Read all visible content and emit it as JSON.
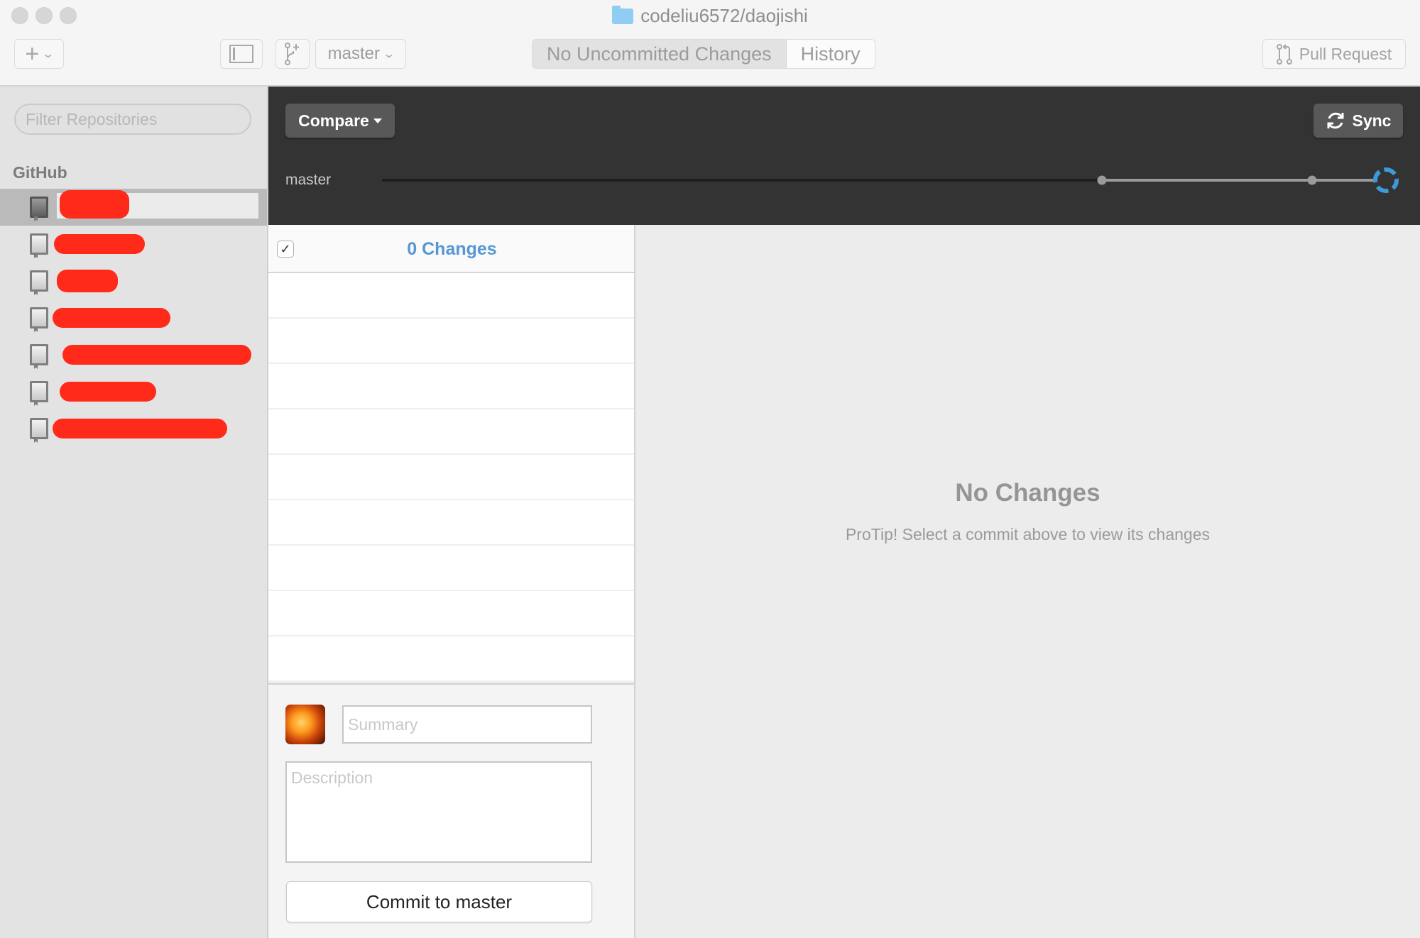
{
  "window": {
    "title": "codeliu6572/daojishi"
  },
  "toolbar": {
    "add_icon": "plus-icon",
    "branch_selector": "master",
    "segments": [
      {
        "label": "No Uncommitted Changes",
        "active": true
      },
      {
        "label": "History",
        "active": false
      }
    ],
    "pull_request_label": "Pull Request"
  },
  "sidebar": {
    "filter_placeholder": "Filter Repositories",
    "section_title": "GitHub",
    "repos": [
      {
        "name": "[redacted]",
        "selected": true
      },
      {
        "name": "[redacted]",
        "selected": false
      },
      {
        "name": "[redacted]",
        "selected": false
      },
      {
        "name": "[redacted]",
        "selected": false
      },
      {
        "name": "[redacted]",
        "selected": false
      },
      {
        "name": "[redacted]",
        "selected": false
      },
      {
        "name": "[redacted]",
        "selected": false
      }
    ]
  },
  "header": {
    "compare_label": "Compare",
    "sync_label": "Sync",
    "branch_label": "master",
    "colors": {
      "current_commit": "#3d9ad8",
      "commit_node": "#9a9a9a"
    }
  },
  "changes": {
    "select_all_checked": true,
    "title": "0 Changes",
    "title_color": "#5598d4",
    "rows": 9
  },
  "commit": {
    "summary_placeholder": "Summary",
    "description_placeholder": "Description",
    "button_label": "Commit to master"
  },
  "detail": {
    "title": "No Changes",
    "tip": "ProTip! Select a commit above to view its changes"
  }
}
